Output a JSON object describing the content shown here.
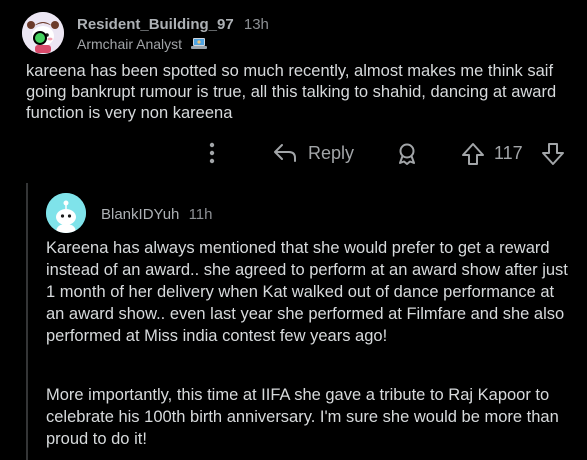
{
  "comment": {
    "username": "Resident_Building_97",
    "time": "13h",
    "flair": "Armchair Analyst",
    "body": "kareena has been spotted so much recently, almost makes me think saif going bankrupt rumour is true, all this talking to shahid, dancing at award function is very non kareena",
    "actions": {
      "reply_label": "Reply",
      "score": "117"
    }
  },
  "reply": {
    "username": "BlankIDYuh",
    "time": "11h",
    "paragraphs": [
      "Kareena has always mentioned that she would prefer to get a reward instead of an award.. she agreed to perform at an award show after just 1 month of her delivery when Kat walked out of dance performance at an award show.. even last year she performed at Filmfare and she also performed at Miss india contest few years ago!",
      "More importantly, this time at IIFA she gave a tribute to Raj Kapoor to celebrate his 100th birth anniversary. I'm sure she would be more than proud to do it!"
    ]
  },
  "colors": {
    "background": "#000000",
    "text": "#d7dadc",
    "muted": "#a2a5a8",
    "online": "#46d160",
    "reply_avatar": "#7fe3ea"
  }
}
